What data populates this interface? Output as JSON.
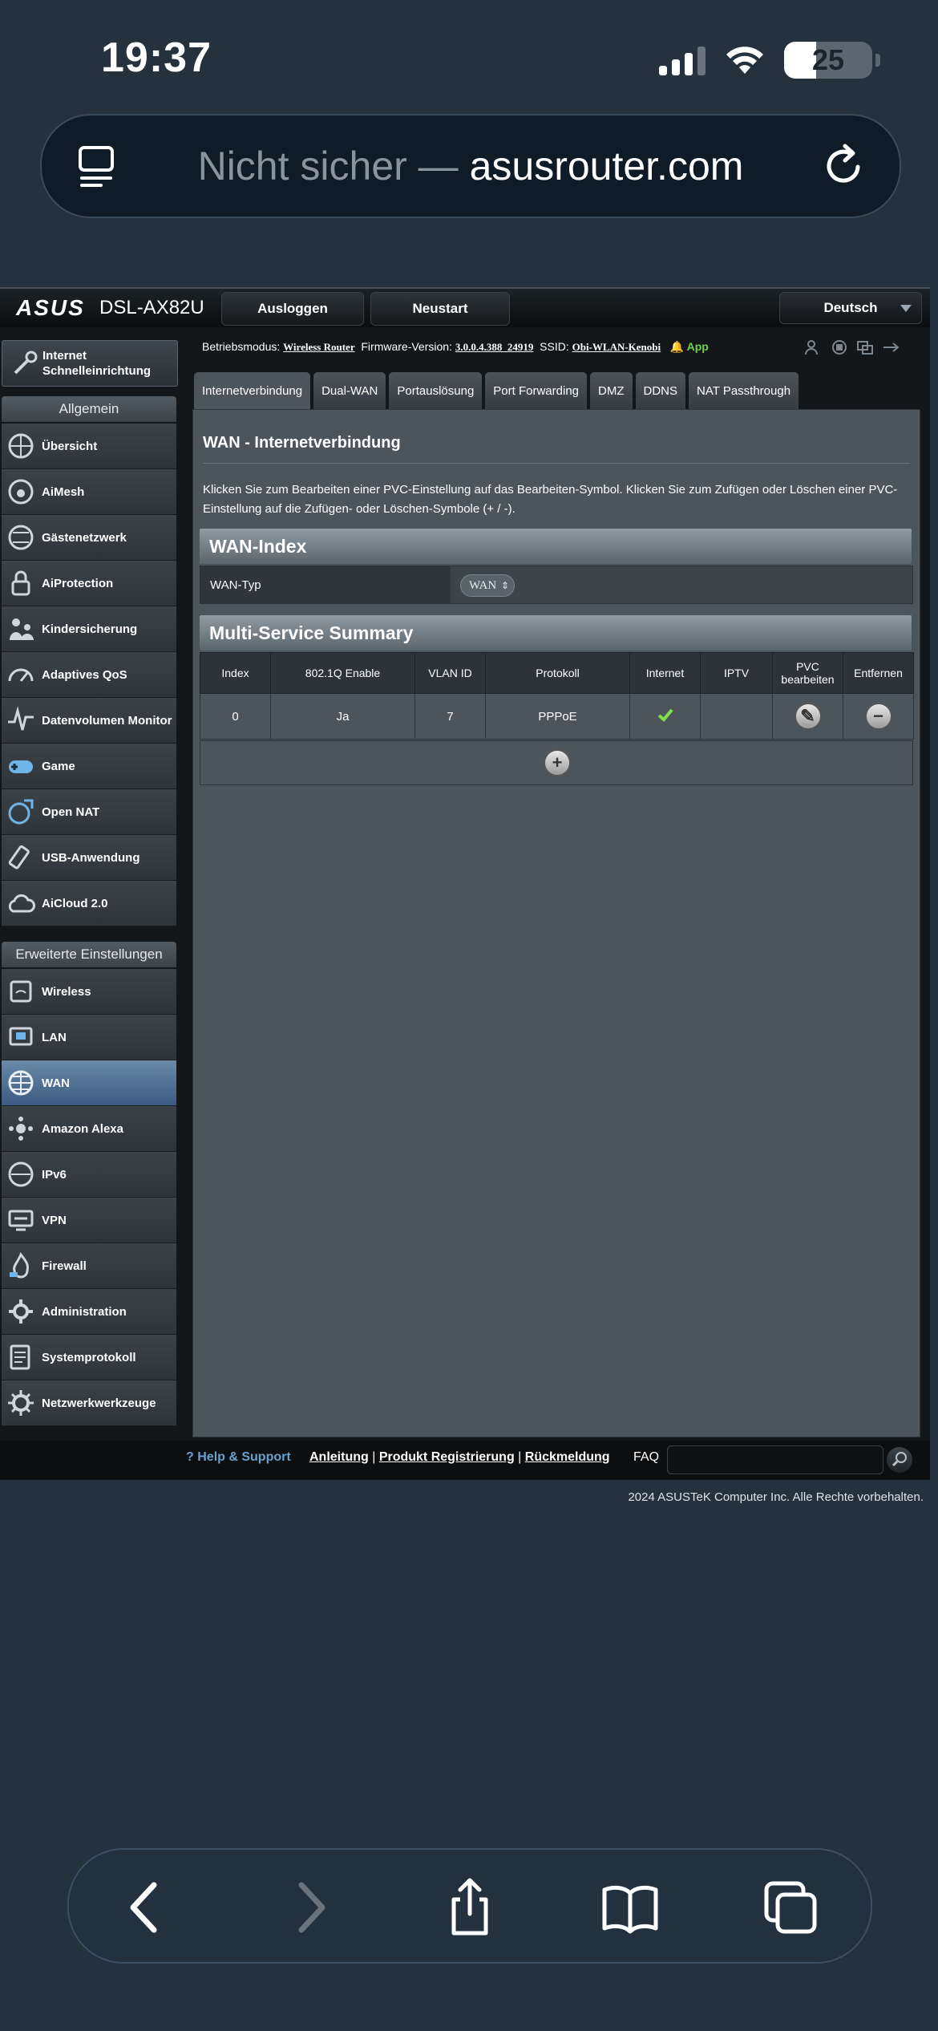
{
  "status": {
    "time": "19:37",
    "battery": "25"
  },
  "browser": {
    "not_secure": "Nicht sicher —",
    "domain": "asusrouter.com"
  },
  "router": {
    "logo": "ASUS",
    "model": "DSL-AX82U",
    "logout": "Ausloggen",
    "reboot": "Neustart",
    "language": "Deutsch",
    "qis": "Internet Schnelleinrichtung",
    "general_head": "Allgemein",
    "general_items": [
      "Übersicht",
      "AiMesh",
      "Gästenetzwerk",
      "AiProtection",
      "Kindersicherung",
      "Adaptives QoS",
      "Datenvolumen Monitor",
      "Game",
      "Open NAT",
      "USB-Anwendung",
      "AiCloud 2.0"
    ],
    "advanced_head": "Erweiterte Einstellungen",
    "advanced_items": [
      "Wireless",
      "LAN",
      "WAN",
      "Amazon Alexa",
      "IPv6",
      "VPN",
      "Firewall",
      "Administration",
      "Systemprotokoll",
      "Netzwerkwerkzeuge"
    ],
    "info": {
      "mode_label": "Betriebsmodus:",
      "mode": "Wireless Router",
      "fw_label": "Firmware-Version:",
      "fw": "3.0.0.4.388_24919",
      "ssid_label": "SSID:",
      "ssid": "Obi-WLAN-Kenobi",
      "app": "App"
    },
    "tabs": [
      "Internetverbindung",
      "Dual-WAN",
      "Portauslösung",
      "Port Forwarding",
      "DMZ",
      "DDNS",
      "NAT Passthrough"
    ],
    "page_title": "WAN - Internetverbindung",
    "description": "Klicken Sie zum Bearbeiten einer PVC-Einstellung auf das Bearbeiten-Symbol. Klicken Sie zum Zufügen oder Löschen einer PVC-Einstellung auf die Zufügen- oder Löschen-Symbole (+ / -).",
    "wan_index_head": "WAN-Index",
    "wan_type_label": "WAN-Typ",
    "wan_type_value": "WAN",
    "summary_head": "Multi-Service Summary",
    "columns": [
      "Index",
      "802.1Q Enable",
      "VLAN ID",
      "Protokoll",
      "Internet",
      "IPTV",
      "PVC bearbeiten",
      "Entfernen"
    ],
    "row": {
      "index": "0",
      "enable": "Ja",
      "vlan": "7",
      "protocol": "PPPoE"
    },
    "footer": {
      "help": "Help & Support",
      "manual": "Anleitung",
      "registration": "Produkt Registrierung",
      "feedback": "Rückmeldung",
      "faq": "FAQ",
      "copyright": "2024 ASUSTeK Computer Inc. Alle Rechte vorbehalten."
    }
  },
  "colors": {
    "accent": "#6aa0d0",
    "app_green": "#6dd34a",
    "active_item": "#4a6c95"
  }
}
